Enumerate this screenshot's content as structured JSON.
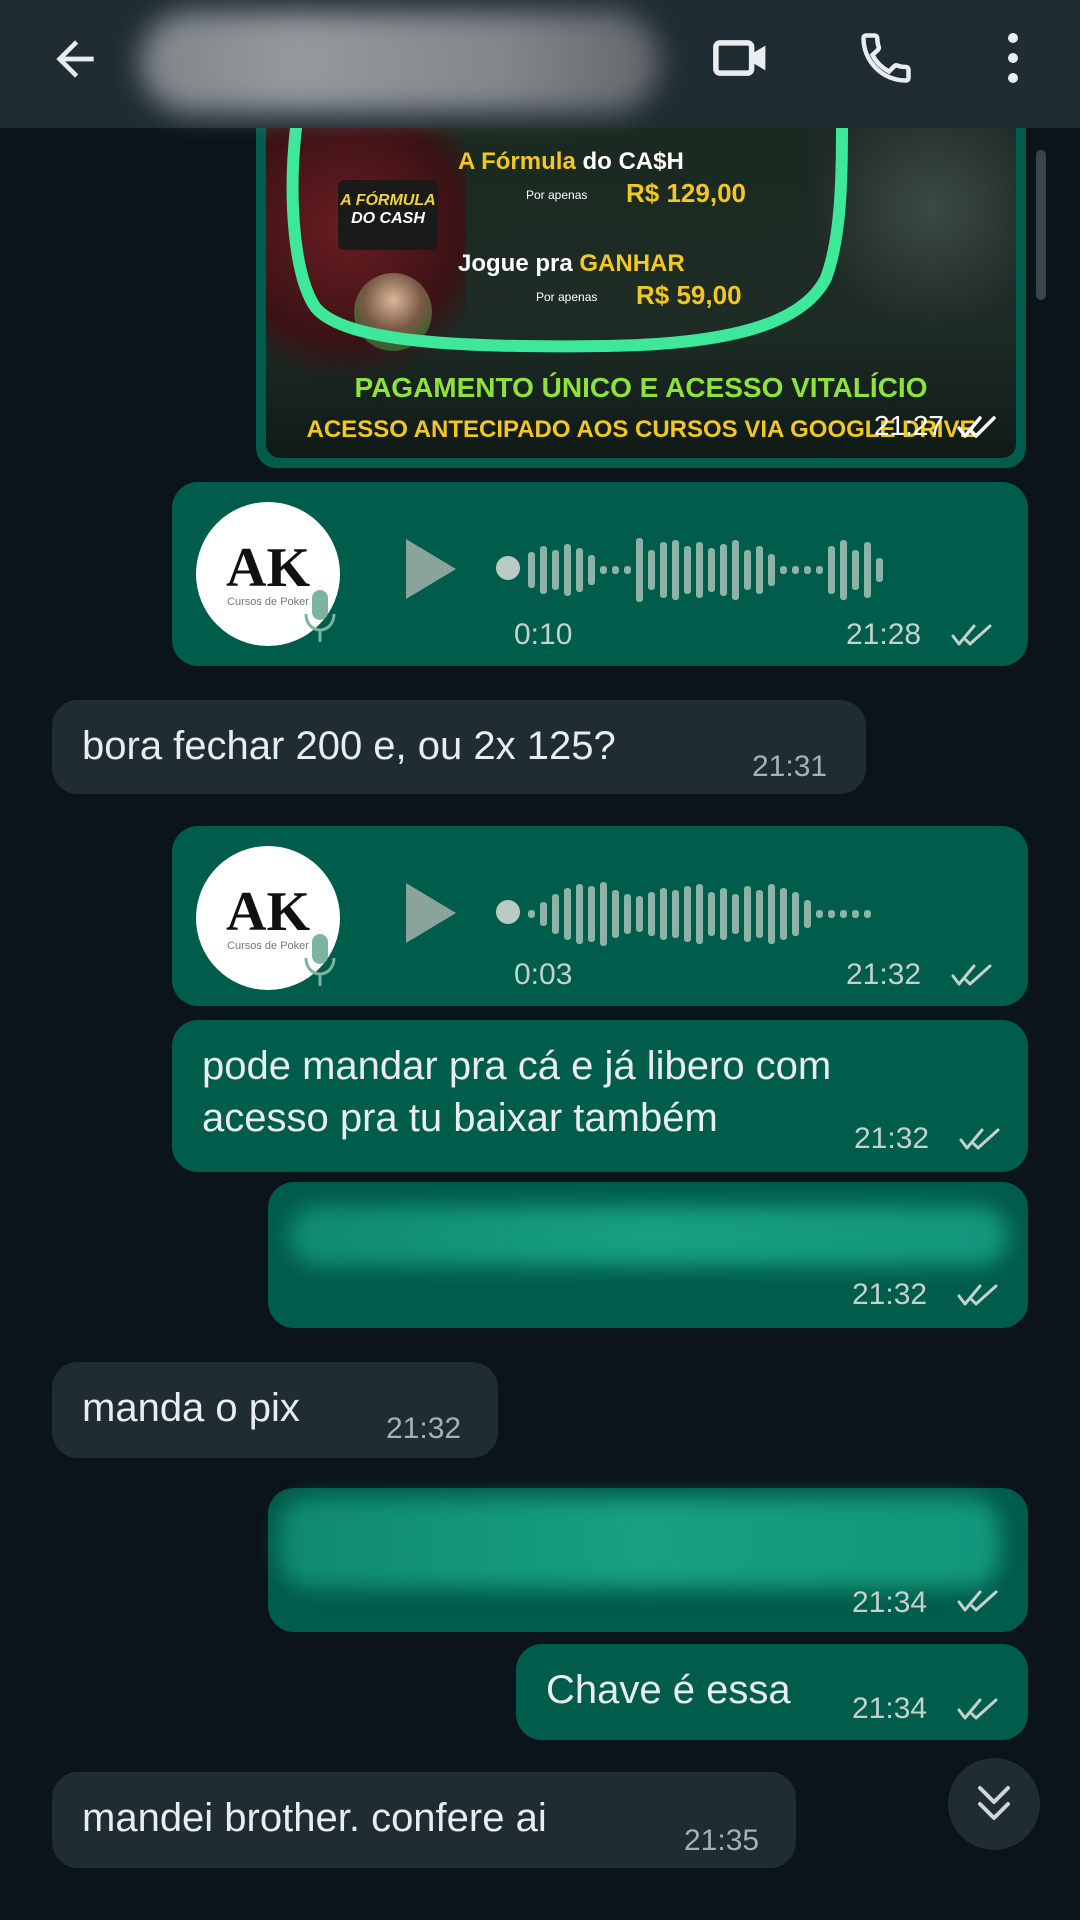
{
  "header": {
    "back_icon": "arrow-left-icon",
    "video_icon": "video-camera-icon",
    "call_icon": "phone-icon",
    "menu_icon": "more-vertical-icon"
  },
  "promo": {
    "logo_line1": "A FÓRMULA",
    "logo_line2": "DO CASH",
    "product1_prefix": "A Fórmula",
    "product1_suffix": " do CA$H",
    "product1_small": "Por apenas",
    "product1_price": "R$ 129,00",
    "product2_prefix": "Jogue pra ",
    "product2_suffix": "GANHAR",
    "product2_small": "Por apenas",
    "product2_price": "R$ 59,00",
    "banner1": "PAGAMENTO ÚNICO E ACESSO VITALÍCIO",
    "banner2": "ACESSO ANTECIPADO AOS CURSOS  VIA GOOGLE DRIVE",
    "time": "21:27"
  },
  "messages": {
    "audio1": {
      "duration": "0:10",
      "time": "21:28",
      "avatar_label": "Cursos de Poker"
    },
    "in1": {
      "text": "bora fechar 200 e, ou 2x 125?",
      "time": "21:31"
    },
    "audio2": {
      "duration": "0:03",
      "time": "21:32",
      "avatar_label": "Cursos de Poker"
    },
    "out1": {
      "text": "pode mandar pra cá e já libero com\nacesso pra tu baixar também",
      "time": "21:32"
    },
    "out_blur1": {
      "time": "21:32"
    },
    "in2": {
      "text": "manda o pix",
      "time": "21:32"
    },
    "out_blur2": {
      "time": "21:34"
    },
    "out2": {
      "text": "Chave é essa",
      "time": "21:34"
    },
    "in3": {
      "text": "mandei brother. confere ai",
      "time": "21:35"
    }
  },
  "colors": {
    "outgoing": "#005c4b",
    "incoming": "#1f2c34",
    "background": "#0b141a",
    "promo_highlight": "#3ee89a"
  }
}
